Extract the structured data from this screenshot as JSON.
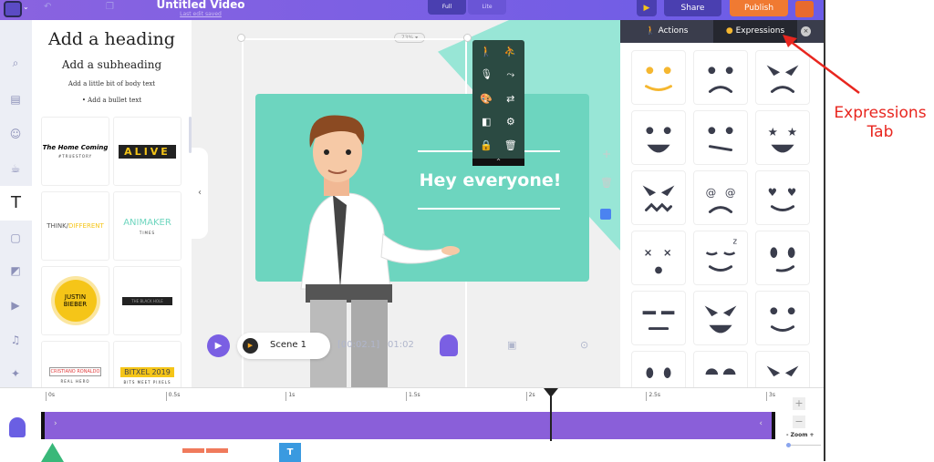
{
  "header": {
    "title": "Untitled Video",
    "saved": "Last edit saved",
    "view_full": "Full",
    "view_lite": "Lite",
    "share": "Share",
    "publish": "Publish"
  },
  "rail": [
    "search-icon",
    "scene-icon",
    "character-icon",
    "props-icon",
    "text-icon",
    "bg-icon",
    "image-icon",
    "video-icon",
    "music-icon",
    "effects-icon",
    "upload-icon"
  ],
  "text_panel": {
    "heading": "Add a heading",
    "subheading": "Add a subheading",
    "body": "Add a little bit of body text",
    "bullet": "Add a bullet text",
    "templates": [
      {
        "t": "The Home Coming",
        "s": "#TRUESTORY"
      },
      {
        "t": "ALIVE",
        "s": ""
      },
      {
        "t": "THINK/",
        "t2": "DIFFERENT",
        "s": ""
      },
      {
        "t": "ANIMAKER",
        "s": "TIMES"
      },
      {
        "t": "JUSTIN BIEBER",
        "s": ""
      },
      {
        "t": "THE BLACK HOLE",
        "s": ""
      },
      {
        "t": "CRISTIANO RONALDO",
        "s": "REAL HERO"
      },
      {
        "t": "BITXEL 2019",
        "s": "BITS MEET PIXELS"
      }
    ]
  },
  "canvas": {
    "zoom": "73%",
    "headline": "Hey everyone!",
    "scene": "Scene 1",
    "time_current": "[00:02.1]",
    "time_total": "01:02",
    "colors": {
      "teal": "#6dd5bf",
      "light_teal": "#98e6d6"
    }
  },
  "right_panel": {
    "tab_actions": "Actions",
    "tab_expressions": "Expressions",
    "active_tab": "Expressions",
    "faces": [
      [
        "dots-yellow",
        "smile-yellow"
      ],
      [
        "dots",
        "frown"
      ],
      [
        "angry",
        "frown"
      ],
      [
        "dots",
        "grin"
      ],
      [
        "dots",
        "skew"
      ],
      [
        "stars",
        "grin"
      ],
      [
        "angry",
        "zigzag"
      ],
      [
        "spiral",
        "frown"
      ],
      [
        "hearts",
        "smile"
      ],
      [
        "x",
        "o"
      ],
      [
        "closed-z",
        "smile"
      ],
      [
        "dots-big",
        "smirk"
      ],
      [
        "lines",
        "flat"
      ],
      [
        "angry",
        "grin"
      ],
      [
        "dots",
        "smile"
      ],
      [
        "dots-big",
        "none"
      ],
      [
        "half",
        "none"
      ],
      [
        "angry",
        "none"
      ]
    ]
  },
  "timeline": {
    "ticks": [
      "0s",
      "0.5s",
      "1s",
      "1.5s",
      "2s",
      "2.5s",
      "3s"
    ],
    "playhead_s": 2.1,
    "zoom_label": "Zoom",
    "zoom_minus": "-",
    "zoom_plus": "+"
  },
  "annotation": {
    "line1": "Expressions",
    "line2": "Tab",
    "color": "#e8261f"
  }
}
